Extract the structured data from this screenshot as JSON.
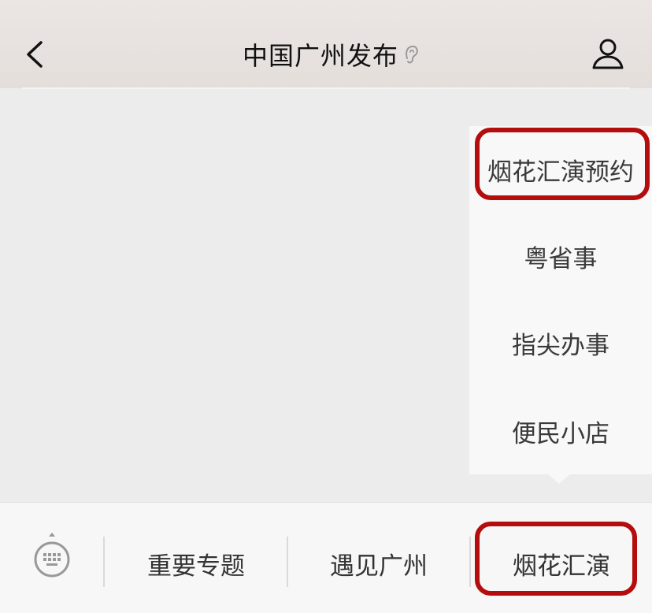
{
  "header": {
    "title": "中国广州发布",
    "back_icon": "chevron-left-icon",
    "title_badge_icon": "ear-icon",
    "profile_icon": "user-icon"
  },
  "popup_menu": {
    "items": [
      {
        "label": "烟花汇演预约",
        "highlighted": true
      },
      {
        "label": "粤省事",
        "highlighted": false
      },
      {
        "label": "指尖办事",
        "highlighted": false
      },
      {
        "label": "便民小店",
        "highlighted": false
      }
    ]
  },
  "bottom_menu": {
    "keyboard_icon": "keyboard-icon",
    "tabs": [
      {
        "label": "重要专题",
        "highlighted": false
      },
      {
        "label": "遇见广州",
        "highlighted": false
      },
      {
        "label": "烟花汇演",
        "highlighted": true
      }
    ]
  },
  "colors": {
    "highlight_border": "#b30d0d",
    "header_bg": "#e8e2df",
    "content_bg": "#ececec"
  }
}
